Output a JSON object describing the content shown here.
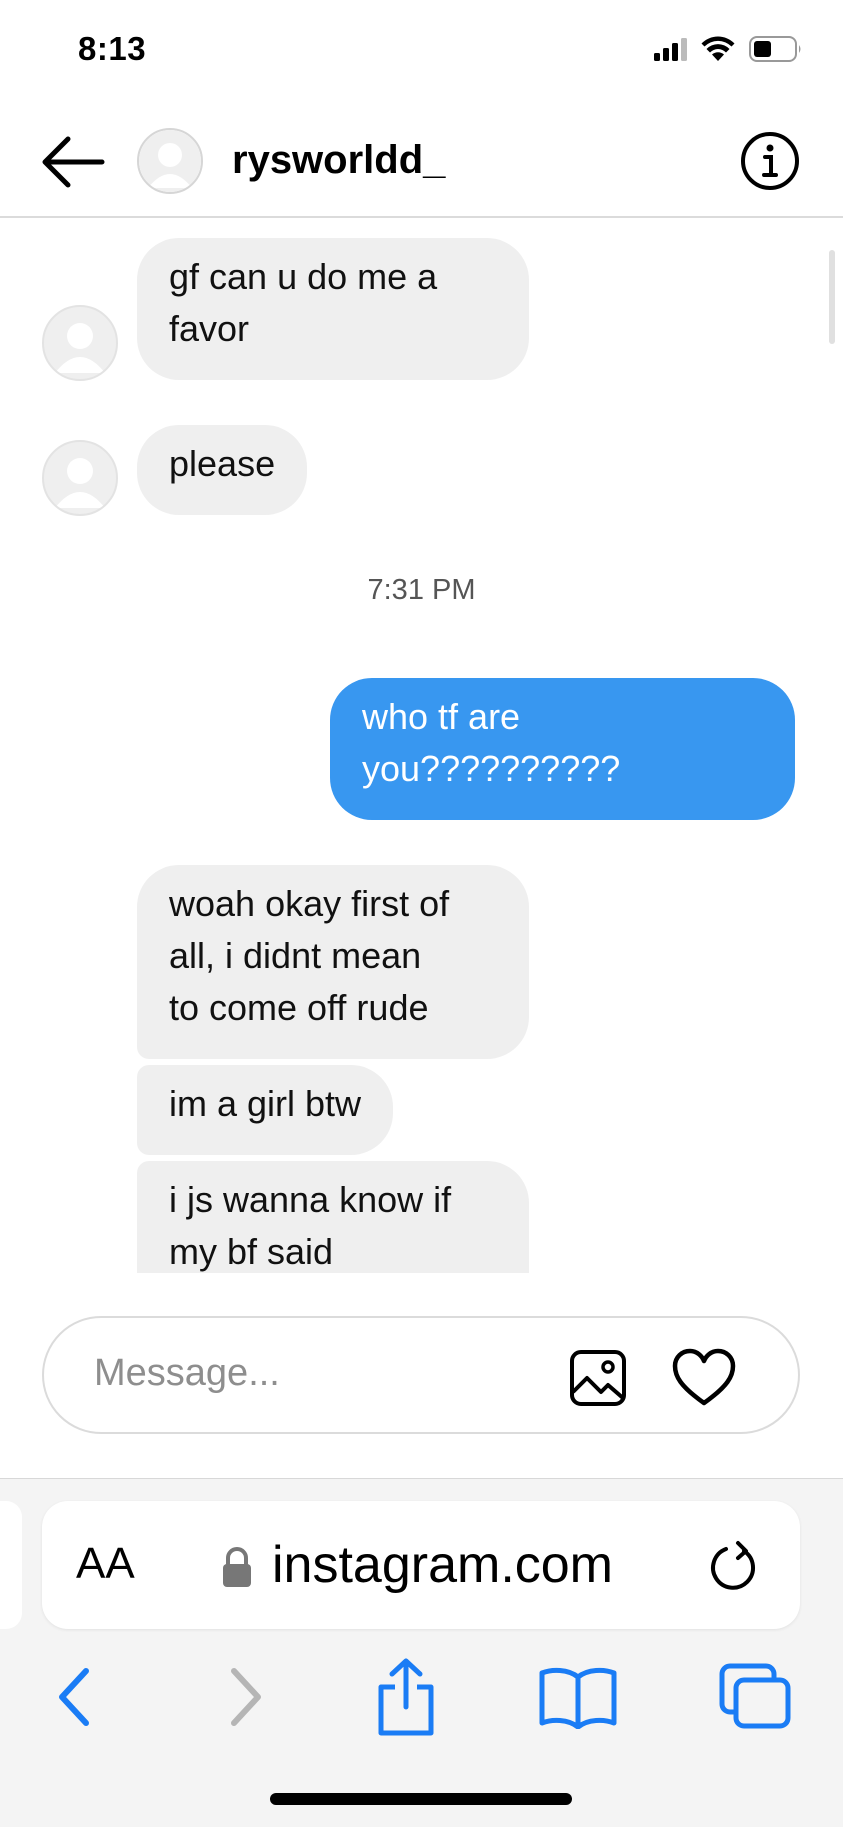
{
  "status_bar": {
    "time": "8:13"
  },
  "header": {
    "username": "rysworldd_"
  },
  "messages": [
    {
      "direction": "in",
      "text": "gf can u do me a favor",
      "lines": [
        "gf can u do me a",
        "favor"
      ]
    },
    {
      "direction": "in",
      "text": "please"
    },
    {
      "type": "timestamp",
      "text": "7:31 PM"
    },
    {
      "direction": "out",
      "text": "who tf are you??????????",
      "lines": [
        "who tf are",
        "you??????????"
      ]
    },
    {
      "direction": "in",
      "text": "woah okay first of all, i didnt mean to come off rude",
      "lines": [
        "woah okay first of",
        "all, i didnt mean",
        "to come off rude"
      ]
    },
    {
      "direction": "in",
      "text": "im a girl btw"
    },
    {
      "direction": "in",
      "text": "i js wanna know if my bf said",
      "lines": [
        "i js wanna know if",
        "my bf said"
      ]
    }
  ],
  "composer": {
    "placeholder": "Message..."
  },
  "safari": {
    "aa_label": "AA",
    "url": "instagram.com"
  },
  "colors": {
    "outgoing_bubble": "#3897f0",
    "incoming_bubble": "#efefef",
    "safari_accent": "#1a7cf5"
  },
  "icons": {
    "back": "arrow-left-icon",
    "info": "info-circle-icon",
    "image": "image-icon",
    "heart": "heart-icon",
    "lock": "lock-icon",
    "reload": "reload-icon",
    "nav_back": "chevron-left-icon",
    "nav_forward": "chevron-right-icon",
    "share": "share-icon",
    "bookmarks": "book-icon",
    "tabs": "tabs-icon"
  }
}
